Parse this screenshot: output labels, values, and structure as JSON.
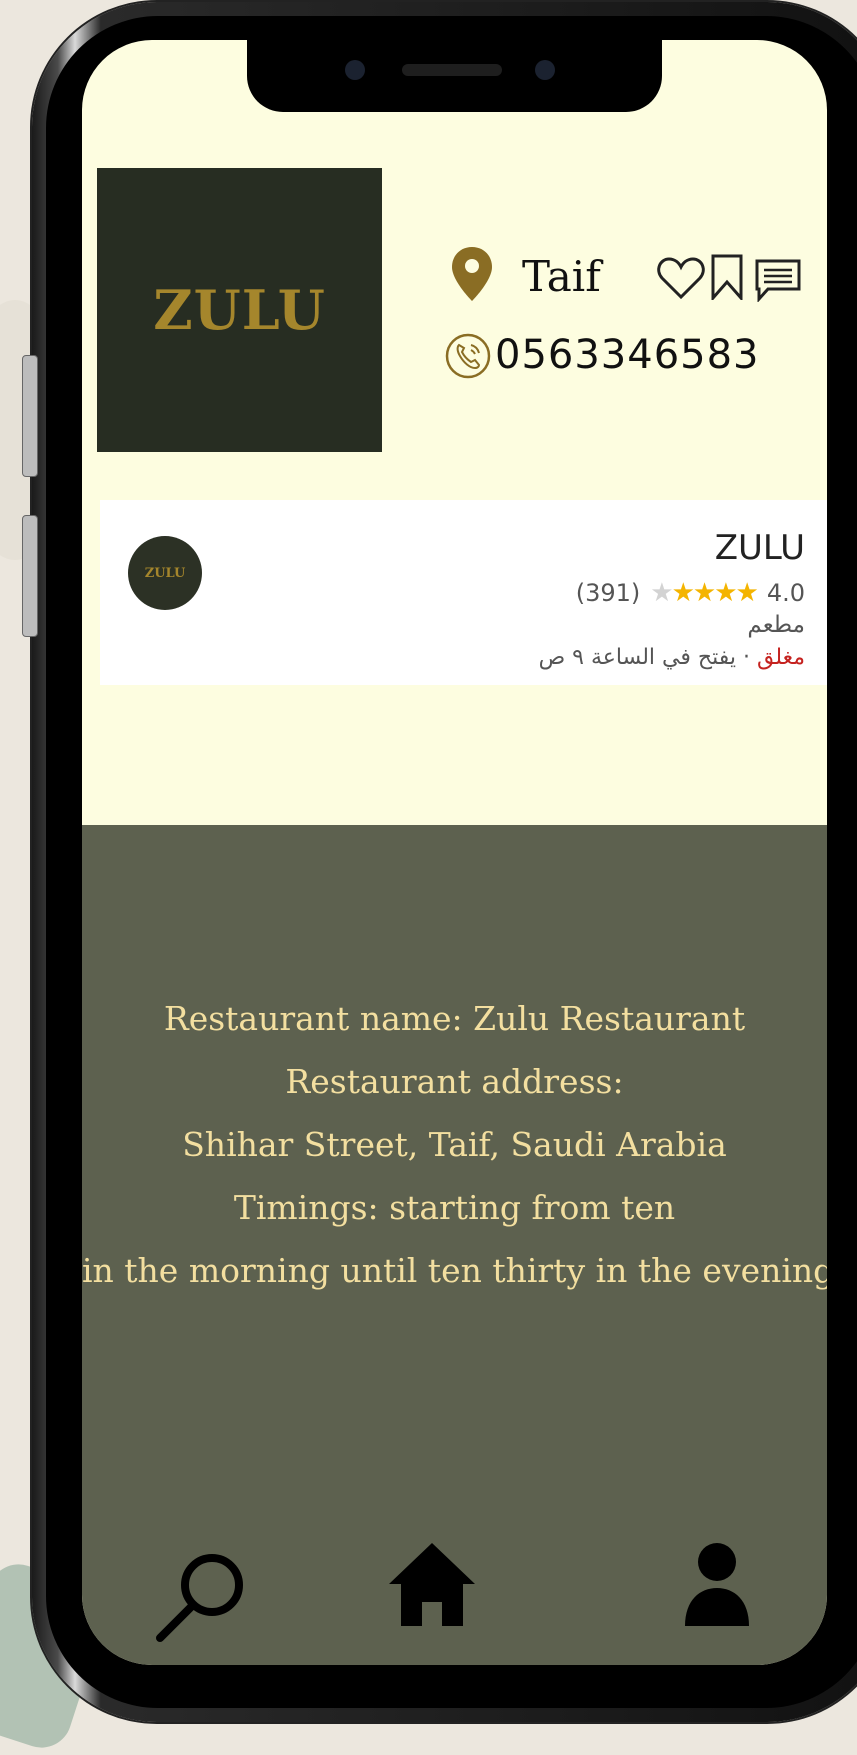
{
  "profile": {
    "logo_text": "ZULU",
    "city": "Taif",
    "phone": "0563346583"
  },
  "place_card": {
    "name": "ZULU",
    "rating": "4.0",
    "reviews": "(391)",
    "stars_filled": 4,
    "stars_total": 5,
    "category": "مطعم",
    "status_closed": "مغلق",
    "status_detail": "· يفتح في الساعة ٩ ص",
    "avatar_text": "ZULU"
  },
  "info": {
    "line1": "Restaurant name: Zulu Restaurant",
    "line2": "Restaurant address:",
    "line3": "Shihar Street, Taif, Saudi Arabia",
    "line4": "Timings: starting from ten",
    "line5": "in the morning until ten thirty in the evening"
  },
  "colors": {
    "screen_bg": "#fdfde0",
    "logo_bg": "#272d22",
    "accent_gold": "#a5862c",
    "info_panel": "#5d614f",
    "info_text": "#f3dfa0",
    "star": "#f4b400",
    "closed_red": "#c5221f"
  },
  "nav": {
    "icons": [
      "search-icon",
      "home-icon",
      "profile-icon"
    ]
  }
}
